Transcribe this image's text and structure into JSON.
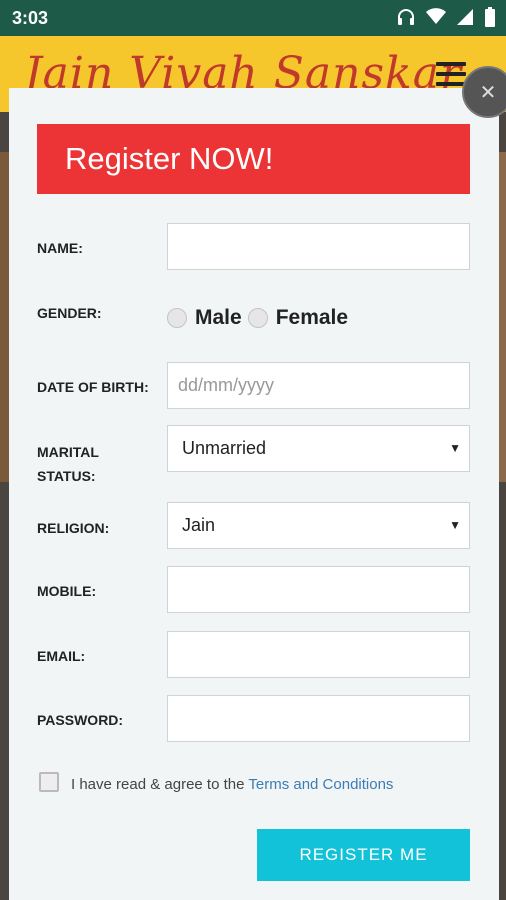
{
  "status": {
    "time": "3:03"
  },
  "header": {
    "logo": "Jain Vivah Sanskar"
  },
  "modal": {
    "title": "Register NOW!",
    "close_symbol": "✕",
    "fields": {
      "name": {
        "label": "NAME:",
        "value": ""
      },
      "gender": {
        "label": "GENDER:",
        "options": [
          "Male",
          "Female"
        ]
      },
      "dob": {
        "label": "DATE OF BIRTH:",
        "placeholder": "dd/mm/yyyy"
      },
      "marital": {
        "label_line1": "MARITAL",
        "label_line2": "STATUS:",
        "selected": "Unmarried"
      },
      "religion": {
        "label": "RELIGION:",
        "selected": "Jain"
      },
      "mobile": {
        "label": "MOBILE:",
        "value": ""
      },
      "email": {
        "label": "EMAIL:",
        "value": ""
      },
      "password": {
        "label": "PASSWORD:",
        "value": ""
      }
    },
    "terms": {
      "prefix": "I have read & agree to the",
      "link": "Terms and Conditions"
    },
    "submit_label": "REGISTER ME"
  },
  "colors": {
    "banner": "#ec3436",
    "button": "#12c2d8",
    "header": "#f6c72d",
    "statusbar": "#1d5a47",
    "link": "#3b7db5"
  },
  "icons": [
    "headphones-icon",
    "wifi-icon",
    "signal-icon",
    "battery-icon",
    "menu-icon",
    "close-icon",
    "chevron-down-icon"
  ]
}
